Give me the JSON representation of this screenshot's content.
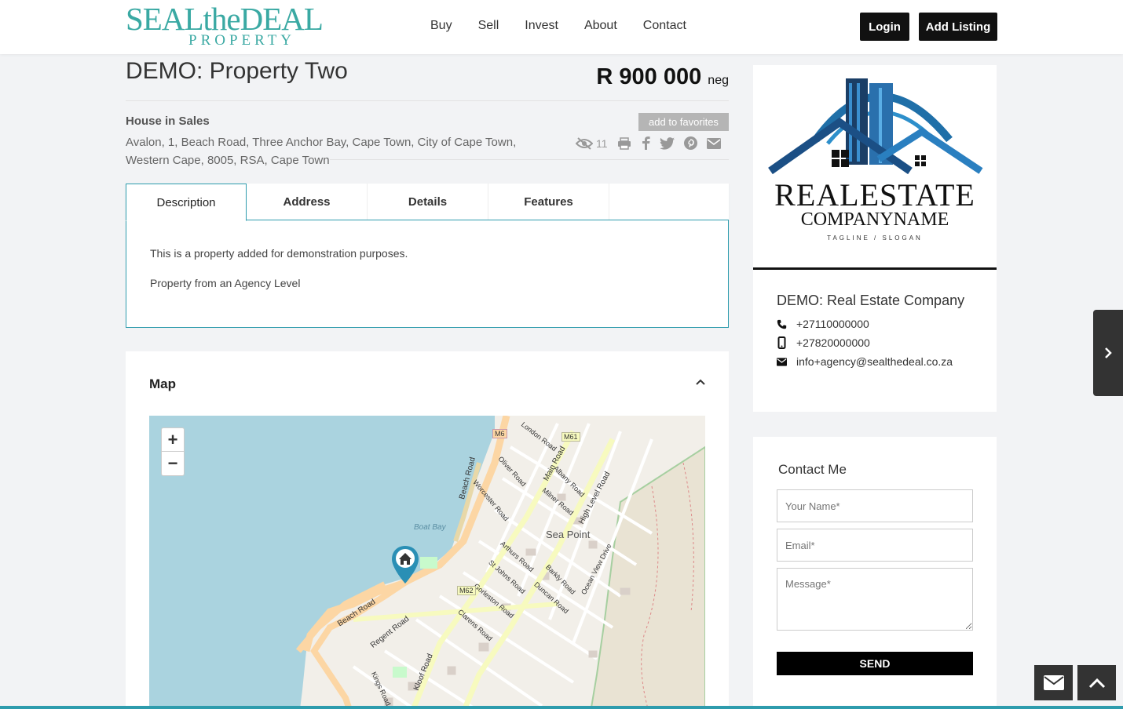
{
  "brand": {
    "logo_line1": "SEALtheDEAL",
    "logo_line2": "PROPERTY",
    "color": "#3aa9a3"
  },
  "nav": {
    "items": [
      "Buy",
      "Sell",
      "Invest",
      "About",
      "Contact"
    ]
  },
  "header": {
    "login_label": "Login",
    "add_listing_label": "Add Listing"
  },
  "property": {
    "title": "DEMO: Property Two",
    "price": "R 900 000",
    "price_suffix": "neg",
    "type": "House in Sales",
    "favorites_label": "add to favorites",
    "address": "Avalon, 1, Beach Road, Three Anchor Bay, Cape Town, City of Cape Town, Western Cape, 8005, RSA, Cape Town",
    "views": "11"
  },
  "tabs": [
    "Description",
    "Address",
    "Details",
    "Features"
  ],
  "description": {
    "line1": "This is a property added for demonstration purposes.",
    "line2": "Property from an Agency Level"
  },
  "map": {
    "heading": "Map",
    "zoom_in": "+",
    "zoom_out": "−",
    "labels": {
      "sea_point": "Sea Point",
      "boat_bay": "Boat Bay",
      "beach_road_upper": "Beach Road",
      "beach_road_lower": "Beach Road",
      "regent_road": "Regent Road",
      "main_road": "Main Road",
      "high_level_road": "High Level Road",
      "kloof_road": "Kloof Road",
      "m6": "M6",
      "m61": "M61",
      "m62": "M62",
      "worcester_road": "Worcester Road",
      "oliver_road": "Oliver Road",
      "milner_road": "Milner Road",
      "albany_road": "Albany Road",
      "london_road": "London Road",
      "arthurs_road": "Arthurs Road",
      "st_johns_road": "St Johns Road",
      "gorleston_road": "Gorleston Road",
      "clarens_road": "Clarens Road",
      "barkly_road": "Barkly Road",
      "duncan_road": "Duncan Road",
      "ocean_view_drive": "Ocean View Drive",
      "kings_road": "Kings Road"
    }
  },
  "agent": {
    "logo_main": "REALESTATE",
    "logo_sub": "COMPANYNAME",
    "logo_tagline": "TAGLINE / SLOGAN",
    "name": "DEMO: Real Estate Company",
    "phone": "+27110000000",
    "mobile": "+27820000000",
    "email": "info+agency@sealthedeal.co.za"
  },
  "contact_form": {
    "title": "Contact Me",
    "name_placeholder": "Your Name*",
    "email_placeholder": "Email*",
    "message_placeholder": "Message*",
    "send_label": "SEND"
  },
  "colors": {
    "accent": "#2e9cad",
    "dark": "#111111"
  }
}
